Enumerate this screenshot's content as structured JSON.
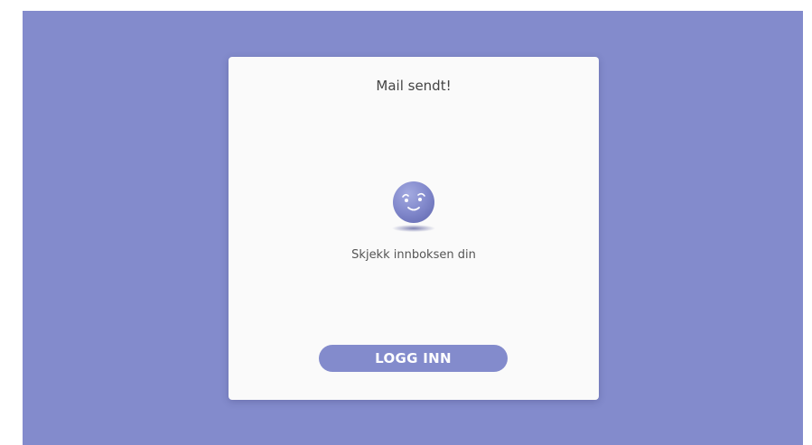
{
  "card": {
    "title": "Mail sendt!",
    "icon": "smiley-face-icon",
    "message": "Skjekk innboksen din",
    "button_label": "LOGG INN"
  },
  "colors": {
    "background": "#838bcc",
    "card": "#fafafa",
    "button": "#838bcc",
    "button_text": "#ffffff"
  }
}
